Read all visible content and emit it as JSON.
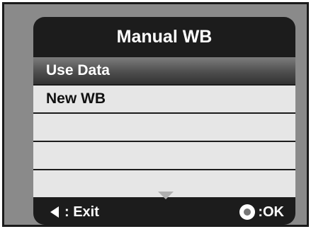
{
  "screen": {
    "title": "Manual WB"
  },
  "menu": {
    "items": [
      {
        "label": "Use Data",
        "selected": true
      },
      {
        "label": "New WB",
        "selected": false
      },
      {
        "label": "",
        "selected": false
      },
      {
        "label": "",
        "selected": false
      },
      {
        "label": "",
        "selected": false
      }
    ]
  },
  "footer": {
    "exit_label": ": Exit",
    "ok_label": ":OK",
    "exit_icon": "left-arrow-icon",
    "ok_icon": "ok-button-icon"
  },
  "colors": {
    "background": "#8a8a8a",
    "screen": "#1c1c1c",
    "row": "#e6e6e6",
    "selected_row": "#4e4e4e",
    "text_light": "#ffffff",
    "text_dark": "#111111"
  }
}
